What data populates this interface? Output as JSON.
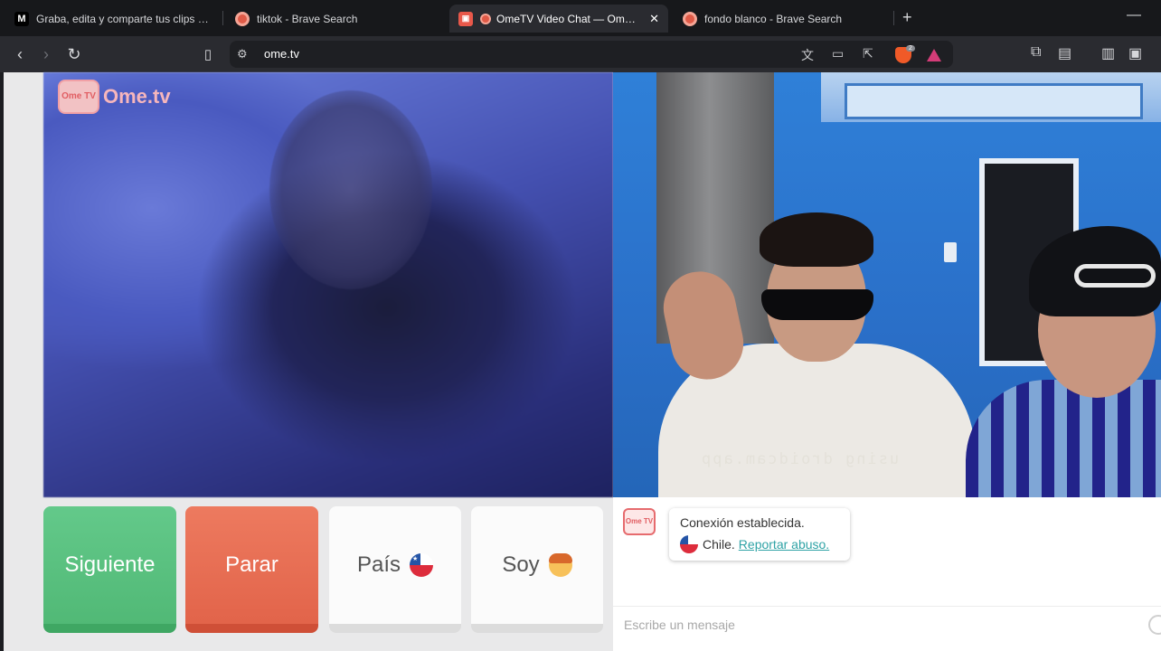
{
  "browser": {
    "tabs": [
      {
        "title": "Graba, edita y comparte tus clips y p",
        "favicon": "m-icon"
      },
      {
        "title": "tiktok - Brave Search",
        "favicon": "brave-icon"
      },
      {
        "title": "OmeTV Video Chat — Omegl",
        "favicon": "ometv-icon",
        "active": true
      },
      {
        "title": "fondo blanco - Brave Search",
        "favicon": "brave-icon"
      }
    ],
    "new_tab": "+",
    "minimize": "—",
    "close_tab": "✕",
    "url": "ome.tv",
    "shield_count": "2"
  },
  "page": {
    "logo_tv_text": "Ome TV",
    "logo_name": "Ome.tv",
    "watermark": "using droidcam.app",
    "buttons": {
      "next": "Siguiente",
      "stop": "Parar",
      "country": "País",
      "gender": "Soy"
    },
    "chat": {
      "logo_text": "Ome TV",
      "status": "Conexión establecida.",
      "country": "Chile.",
      "report": "Reportar abuso.",
      "input_placeholder": "Escribe un mensaje"
    }
  },
  "colors": {
    "next": "#51b976",
    "stop": "#e2644a",
    "link": "#2fa3a6",
    "tab_active": "#2a2b30"
  }
}
